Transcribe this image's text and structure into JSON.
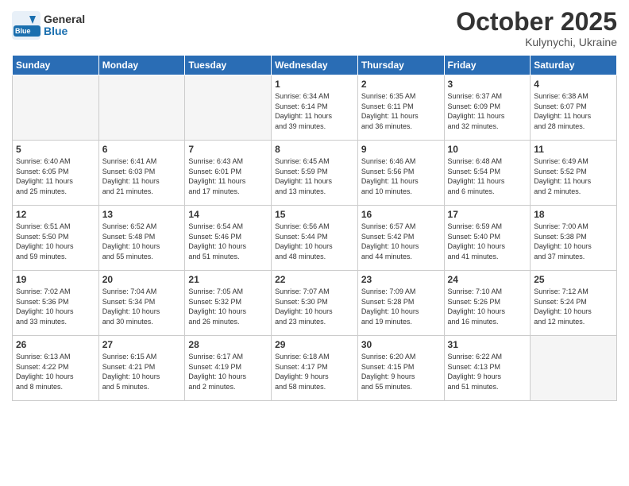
{
  "header": {
    "logo_line1": "General",
    "logo_line2": "Blue",
    "month": "October 2025",
    "location": "Kulynychi, Ukraine"
  },
  "weekdays": [
    "Sunday",
    "Monday",
    "Tuesday",
    "Wednesday",
    "Thursday",
    "Friday",
    "Saturday"
  ],
  "weeks": [
    [
      {
        "day": "",
        "info": ""
      },
      {
        "day": "",
        "info": ""
      },
      {
        "day": "",
        "info": ""
      },
      {
        "day": "1",
        "info": "Sunrise: 6:34 AM\nSunset: 6:14 PM\nDaylight: 11 hours\nand 39 minutes."
      },
      {
        "day": "2",
        "info": "Sunrise: 6:35 AM\nSunset: 6:11 PM\nDaylight: 11 hours\nand 36 minutes."
      },
      {
        "day": "3",
        "info": "Sunrise: 6:37 AM\nSunset: 6:09 PM\nDaylight: 11 hours\nand 32 minutes."
      },
      {
        "day": "4",
        "info": "Sunrise: 6:38 AM\nSunset: 6:07 PM\nDaylight: 11 hours\nand 28 minutes."
      }
    ],
    [
      {
        "day": "5",
        "info": "Sunrise: 6:40 AM\nSunset: 6:05 PM\nDaylight: 11 hours\nand 25 minutes."
      },
      {
        "day": "6",
        "info": "Sunrise: 6:41 AM\nSunset: 6:03 PM\nDaylight: 11 hours\nand 21 minutes."
      },
      {
        "day": "7",
        "info": "Sunrise: 6:43 AM\nSunset: 6:01 PM\nDaylight: 11 hours\nand 17 minutes."
      },
      {
        "day": "8",
        "info": "Sunrise: 6:45 AM\nSunset: 5:59 PM\nDaylight: 11 hours\nand 13 minutes."
      },
      {
        "day": "9",
        "info": "Sunrise: 6:46 AM\nSunset: 5:56 PM\nDaylight: 11 hours\nand 10 minutes."
      },
      {
        "day": "10",
        "info": "Sunrise: 6:48 AM\nSunset: 5:54 PM\nDaylight: 11 hours\nand 6 minutes."
      },
      {
        "day": "11",
        "info": "Sunrise: 6:49 AM\nSunset: 5:52 PM\nDaylight: 11 hours\nand 2 minutes."
      }
    ],
    [
      {
        "day": "12",
        "info": "Sunrise: 6:51 AM\nSunset: 5:50 PM\nDaylight: 10 hours\nand 59 minutes."
      },
      {
        "day": "13",
        "info": "Sunrise: 6:52 AM\nSunset: 5:48 PM\nDaylight: 10 hours\nand 55 minutes."
      },
      {
        "day": "14",
        "info": "Sunrise: 6:54 AM\nSunset: 5:46 PM\nDaylight: 10 hours\nand 51 minutes."
      },
      {
        "day": "15",
        "info": "Sunrise: 6:56 AM\nSunset: 5:44 PM\nDaylight: 10 hours\nand 48 minutes."
      },
      {
        "day": "16",
        "info": "Sunrise: 6:57 AM\nSunset: 5:42 PM\nDaylight: 10 hours\nand 44 minutes."
      },
      {
        "day": "17",
        "info": "Sunrise: 6:59 AM\nSunset: 5:40 PM\nDaylight: 10 hours\nand 41 minutes."
      },
      {
        "day": "18",
        "info": "Sunrise: 7:00 AM\nSunset: 5:38 PM\nDaylight: 10 hours\nand 37 minutes."
      }
    ],
    [
      {
        "day": "19",
        "info": "Sunrise: 7:02 AM\nSunset: 5:36 PM\nDaylight: 10 hours\nand 33 minutes."
      },
      {
        "day": "20",
        "info": "Sunrise: 7:04 AM\nSunset: 5:34 PM\nDaylight: 10 hours\nand 30 minutes."
      },
      {
        "day": "21",
        "info": "Sunrise: 7:05 AM\nSunset: 5:32 PM\nDaylight: 10 hours\nand 26 minutes."
      },
      {
        "day": "22",
        "info": "Sunrise: 7:07 AM\nSunset: 5:30 PM\nDaylight: 10 hours\nand 23 minutes."
      },
      {
        "day": "23",
        "info": "Sunrise: 7:09 AM\nSunset: 5:28 PM\nDaylight: 10 hours\nand 19 minutes."
      },
      {
        "day": "24",
        "info": "Sunrise: 7:10 AM\nSunset: 5:26 PM\nDaylight: 10 hours\nand 16 minutes."
      },
      {
        "day": "25",
        "info": "Sunrise: 7:12 AM\nSunset: 5:24 PM\nDaylight: 10 hours\nand 12 minutes."
      }
    ],
    [
      {
        "day": "26",
        "info": "Sunrise: 6:13 AM\nSunset: 4:22 PM\nDaylight: 10 hours\nand 8 minutes."
      },
      {
        "day": "27",
        "info": "Sunrise: 6:15 AM\nSunset: 4:21 PM\nDaylight: 10 hours\nand 5 minutes."
      },
      {
        "day": "28",
        "info": "Sunrise: 6:17 AM\nSunset: 4:19 PM\nDaylight: 10 hours\nand 2 minutes."
      },
      {
        "day": "29",
        "info": "Sunrise: 6:18 AM\nSunset: 4:17 PM\nDaylight: 9 hours\nand 58 minutes."
      },
      {
        "day": "30",
        "info": "Sunrise: 6:20 AM\nSunset: 4:15 PM\nDaylight: 9 hours\nand 55 minutes."
      },
      {
        "day": "31",
        "info": "Sunrise: 6:22 AM\nSunset: 4:13 PM\nDaylight: 9 hours\nand 51 minutes."
      },
      {
        "day": "",
        "info": ""
      }
    ]
  ]
}
